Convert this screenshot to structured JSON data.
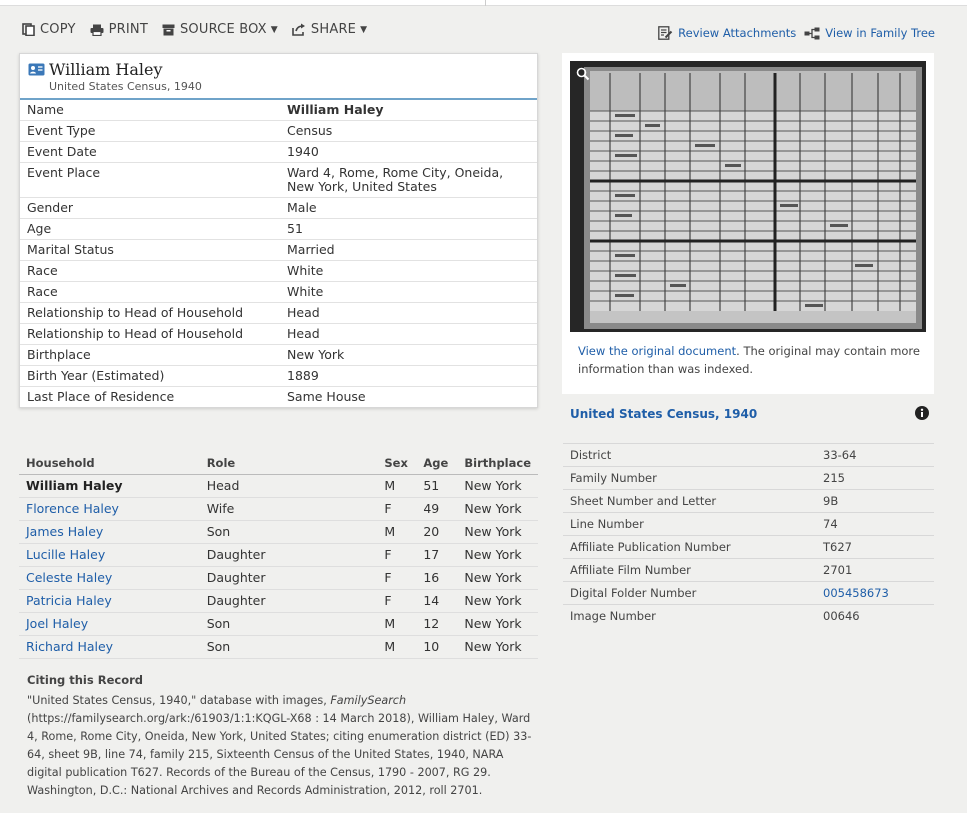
{
  "toolbar": {
    "copy": "COPY",
    "print": "PRINT",
    "source_box": "SOURCE BOX",
    "share": "SHARE"
  },
  "links": {
    "review_attachments": "Review Attachments",
    "view_family_tree": "View in Family Tree"
  },
  "person": {
    "name": "William Haley",
    "collection": "United States Census, 1940"
  },
  "facts": [
    {
      "label": "Name",
      "value": "William Haley"
    },
    {
      "label": "Event Type",
      "value": "Census"
    },
    {
      "label": "Event Date",
      "value": "1940"
    },
    {
      "label": "Event Place",
      "value": "Ward 4, Rome, Rome City, Oneida, New York, United States"
    },
    {
      "label": "Gender",
      "value": "Male"
    },
    {
      "label": "Age",
      "value": "51"
    },
    {
      "label": "Marital Status",
      "value": "Married"
    },
    {
      "label": "Race",
      "value": "White"
    },
    {
      "label": "Race",
      "value": "White"
    },
    {
      "label": "Relationship to Head of Household",
      "value": "Head"
    },
    {
      "label": "Relationship to Head of Household",
      "value": "Head"
    },
    {
      "label": "Birthplace",
      "value": "New York"
    },
    {
      "label": "Birth Year (Estimated)",
      "value": "1889"
    },
    {
      "label": "Last Place of Residence",
      "value": "Same House"
    }
  ],
  "household": {
    "headers": {
      "name": "Household",
      "role": "Role",
      "sex": "Sex",
      "age": "Age",
      "birthplace": "Birthplace"
    },
    "members": [
      {
        "name": "William Haley",
        "role": "Head",
        "sex": "M",
        "age": "51",
        "birthplace": "New York"
      },
      {
        "name": "Florence Haley",
        "role": "Wife",
        "sex": "F",
        "age": "49",
        "birthplace": "New York"
      },
      {
        "name": "James Haley",
        "role": "Son",
        "sex": "M",
        "age": "20",
        "birthplace": "New York"
      },
      {
        "name": "Lucille Haley",
        "role": "Daughter",
        "sex": "F",
        "age": "17",
        "birthplace": "New York"
      },
      {
        "name": "Celeste Haley",
        "role": "Daughter",
        "sex": "F",
        "age": "16",
        "birthplace": "New York"
      },
      {
        "name": "Patricia Haley",
        "role": "Daughter",
        "sex": "F",
        "age": "14",
        "birthplace": "New York"
      },
      {
        "name": "Joel Haley",
        "role": "Son",
        "sex": "M",
        "age": "12",
        "birthplace": "New York"
      },
      {
        "name": "Richard Haley",
        "role": "Son",
        "sex": "M",
        "age": "10",
        "birthplace": "New York"
      }
    ]
  },
  "citation": {
    "heading": "Citing this Record",
    "part1": "\"United States Census, 1940,\" database with images, ",
    "italic": "FamilySearch",
    "part2": " (https://familysearch.org/ark:/61903/1:1:KQGL-X68 : 14 March 2018), William Haley, Ward 4, Rome, Rome City, Oneida, New York, United States; citing enumeration district (ED) 33-64, sheet 9B, line 74, family 215, Sixteenth Census of the United States, 1940, NARA digital publication T627. Records of the Bureau of the Census, 1790 - 2007, RG 29. Washington, D.C.: National Archives and Records Administration, 2012, roll 2701."
  },
  "image_panel": {
    "link": "View the original document",
    "note": ". The original may contain more information than was indexed."
  },
  "collection_link": "United States Census, 1940",
  "meta": [
    {
      "label": "District",
      "value": "33-64"
    },
    {
      "label": "Family Number",
      "value": "215"
    },
    {
      "label": "Sheet Number and Letter",
      "value": "9B"
    },
    {
      "label": "Line Number",
      "value": "74"
    },
    {
      "label": "Affiliate Publication Number",
      "value": "T627"
    },
    {
      "label": "Affiliate Film Number",
      "value": "2701"
    },
    {
      "label": "Digital Folder Number",
      "value": "005458673"
    },
    {
      "label": "Image Number",
      "value": "00646"
    }
  ],
  "colors": {
    "link": "#1f5ea8",
    "accent": "#6fa3c9",
    "background": "#f0f0ee"
  }
}
